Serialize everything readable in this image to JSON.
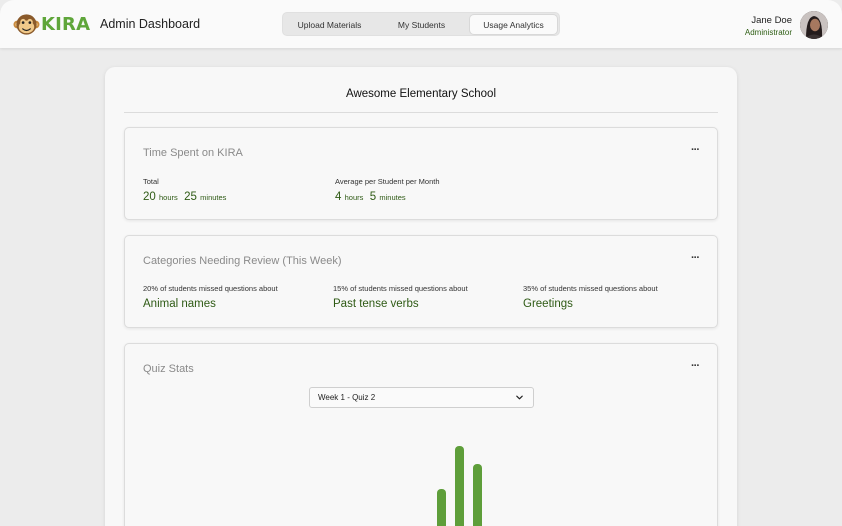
{
  "header": {
    "logo_text": "KIRA",
    "title": "Admin Dashboard",
    "tabs": [
      "Upload Materials",
      "My Students",
      "Usage Analytics"
    ],
    "active_tab": "Usage Analytics",
    "user_name": "Jane Doe",
    "user_role": "Administrator"
  },
  "school_name": "Awesome Elementary School",
  "time_card": {
    "title": "Time Spent on KIRA",
    "more": "···",
    "total_label": "Total",
    "total_hours": "20",
    "total_minutes": "25",
    "avg_label": "Average per Student per Month",
    "avg_hours": "4",
    "avg_minutes": "5",
    "hours_unit": "hours",
    "minutes_unit": "minutes"
  },
  "review_card": {
    "title": "Categories Needing Review (This Week)",
    "more": "···",
    "items": [
      {
        "label": "20% of students missed questions about",
        "value": "Animal names"
      },
      {
        "label": "15% of students missed questions about",
        "value": "Past tense verbs"
      },
      {
        "label": "35% of students missed questions about",
        "value": "Greetings"
      }
    ]
  },
  "quiz_card": {
    "title": "Quiz Stats",
    "more": "···",
    "selected_quiz": "Week 1 - Quiz 2",
    "bar_color": "#5e9e3a"
  },
  "chart_data": {
    "type": "bar",
    "values": [
      37,
      80,
      62
    ]
  },
  "colors": {
    "brand_green": "#5fa63a",
    "value_green": "#2e5a14"
  }
}
